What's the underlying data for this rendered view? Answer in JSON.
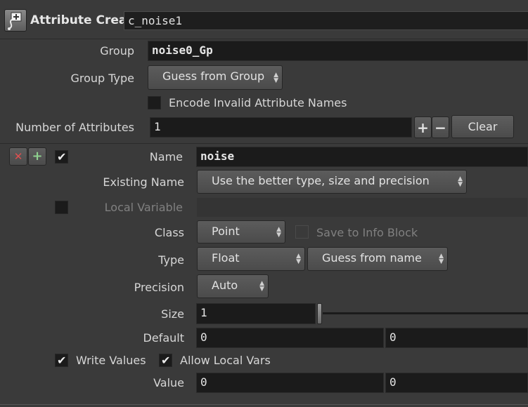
{
  "node": {
    "type_label": "Attribute Create",
    "name": "c_noise1"
  },
  "group": {
    "label": "Group",
    "value": "noise0_Gp"
  },
  "group_type": {
    "label": "Group Type",
    "value": "Guess from Group"
  },
  "encode_invalid": {
    "label": "Encode Invalid Attribute Names",
    "checked": false
  },
  "num_attributes": {
    "label": "Number of Attributes",
    "value": "1",
    "add_symbol": "+",
    "remove_symbol": "−",
    "clear_label": "Clear"
  },
  "attribute": {
    "delete_symbol": "✕",
    "insert_symbol": "+",
    "enabled": true,
    "name_label": "Name",
    "name_value": "noise",
    "existing_name_label": "Existing Name",
    "existing_name_value": "Use the better type, size and precision",
    "local_variable_label": "Local Variable",
    "local_variable_value": "",
    "class_label": "Class",
    "class_value": "Point",
    "save_info_label": "Save to Info Block",
    "type_label": "Type",
    "type_value": "Float",
    "type_info_value": "Guess from name",
    "precision_label": "Precision",
    "precision_value": "Auto",
    "size_label": "Size",
    "size_value": "1",
    "size_slider_fraction": 0.0,
    "default_label": "Default",
    "default_values": [
      "0",
      "0"
    ],
    "write_values_label": "Write Values",
    "write_values_checked": true,
    "allow_local_label": "Allow Local Vars",
    "allow_local_checked": true,
    "value_label": "Value",
    "value_values": [
      "0",
      "0"
    ]
  },
  "colors": {
    "background": "#3a3a3a",
    "field": "#1b1b1b",
    "delete_red": "#e05050",
    "insert_green": "#8fd18f"
  }
}
